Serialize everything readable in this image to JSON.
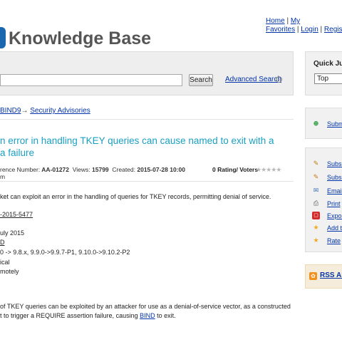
{
  "header": {
    "logo_text": "Knowledge Base",
    "top_links": {
      "home": "Home",
      "my": "My",
      "favorites": "Favorites",
      "login": "Login",
      "registration": "Registrati"
    }
  },
  "search": {
    "button_label": "Search",
    "advanced_label": "Advanced Search"
  },
  "breadcrumb": {
    "items": [
      "BIND9",
      "Security Advisories"
    ],
    "separator": "→"
  },
  "article": {
    "title_line1": "n error in handling TKEY queries can cause named to exit with a",
    "title_line2": "a failure",
    "meta": {
      "ref_label": "rence Number:",
      "ref_value": "AA-01272",
      "views_label": "Views:",
      "views_value": "15799",
      "created_label": "Created:",
      "created_value": "2015-07-28 10:00",
      "created_time_suffix": "m"
    },
    "rating_text": "0 Rating/ Voters",
    "stars": "★★★★★",
    "summary": "ket can exploit an error in the handling of queries for TKEY records, permitting denial of service.",
    "cve": "-2015-5477",
    "date": "uly 2015",
    "link_fragment": "D",
    "versions": "0 -> 9.8.x, 9.9.0->9.9.7-P1, 9.10.0->9.10.2-P2",
    "severity": "ical",
    "exploit": "motely",
    "desc_line1": "of TKEY queries can be exploited by an attacker for use as a denial-of-service vector, as a constructed",
    "desc_line2a": "t to trigger a REQUIRE assertion failure, causing ",
    "desc_bind": "BIND",
    "desc_line2b": " to exit."
  },
  "sidebar": {
    "quick_jump_title": "Quick Jum",
    "quick_jump_selected": "Top",
    "submit_label": "Submi",
    "actions": [
      {
        "label": "Subsc",
        "icon": "pencil-icon"
      },
      {
        "label": "Subsc",
        "icon": "pencil-icon"
      },
      {
        "label": "Email",
        "icon": "email-icon"
      },
      {
        "label": "Print",
        "icon": "print-icon"
      },
      {
        "label": "Expor",
        "icon": "pdf-icon"
      },
      {
        "label": "Add t",
        "icon": "star-icon"
      },
      {
        "label": "Rate",
        "icon": "star-icon"
      }
    ],
    "rss_label": "RSS Ar"
  },
  "colors": {
    "title": "#1a9fc4",
    "link": "#0033aa",
    "logo_accent": "#1a67b0",
    "rss": "#f0901e"
  }
}
